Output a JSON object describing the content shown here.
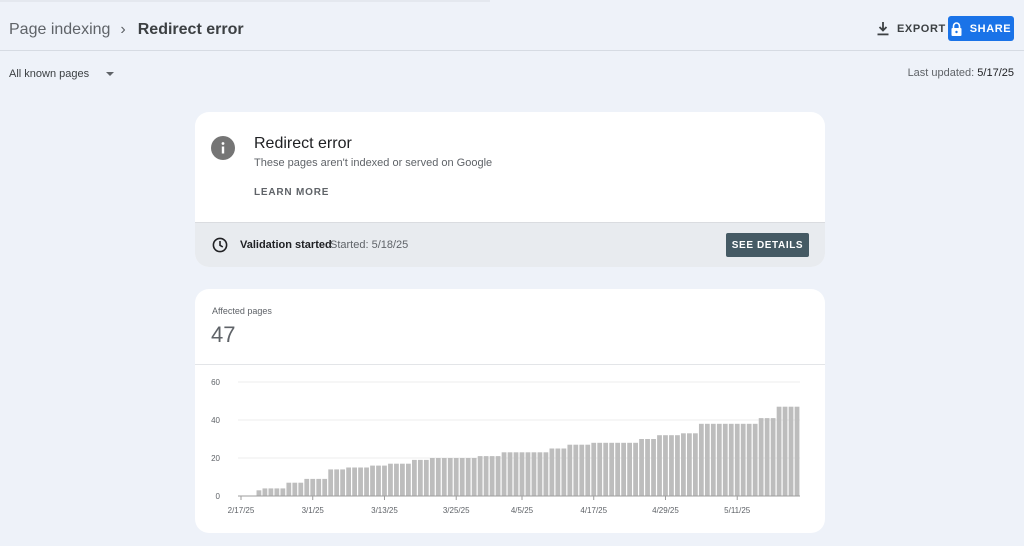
{
  "header": {
    "breadcrumb_parent": "Page indexing",
    "breadcrumb_sep": "›",
    "breadcrumb_current": "Redirect error",
    "export_label": "EXPORT",
    "share_label": "SHARE",
    "accent_color": "#1a73e8"
  },
  "filter": {
    "selected": "All known pages"
  },
  "last_updated": {
    "label": "Last updated:",
    "value": "5/17/25"
  },
  "issue": {
    "icon": "info-icon",
    "title": "Redirect error",
    "subtitle": "These pages aren't indexed or served on Google",
    "learn_more": "LEARN MORE"
  },
  "validation": {
    "icon": "clock-icon",
    "status": "Validation started",
    "started": "Started: 5/18/25",
    "details_label": "SEE DETAILS",
    "button_color": "#455a64"
  },
  "affected": {
    "label": "Affected pages",
    "value": "47"
  },
  "chart_data": {
    "type": "bar",
    "bar_color": "#bdbdbd",
    "ylim": [
      0,
      60
    ],
    "yticks": [
      0,
      20,
      40,
      60
    ],
    "xtick_labels": [
      "2/17/25",
      "3/1/25",
      "3/13/25",
      "3/25/25",
      "4/5/25",
      "4/17/25",
      "4/29/25",
      "5/11/25"
    ],
    "xtick_indices": [
      0,
      12,
      24,
      36,
      47,
      59,
      71,
      83
    ],
    "values": [
      0,
      0,
      0,
      3,
      4,
      4,
      4,
      4,
      7,
      7,
      7,
      9,
      9,
      9,
      9,
      14,
      14,
      14,
      15,
      15,
      15,
      15,
      16,
      16,
      16,
      17,
      17,
      17,
      17,
      19,
      19,
      19,
      20,
      20,
      20,
      20,
      20,
      20,
      20,
      20,
      21,
      21,
      21,
      21,
      23,
      23,
      23,
      23,
      23,
      23,
      23,
      23,
      25,
      25,
      25,
      27,
      27,
      27,
      27,
      28,
      28,
      28,
      28,
      28,
      28,
      28,
      28,
      30,
      30,
      30,
      32,
      32,
      32,
      32,
      33,
      33,
      33,
      38,
      38,
      38,
      38,
      38,
      38,
      38,
      38,
      38,
      38,
      41,
      41,
      41,
      47,
      47,
      47,
      47
    ]
  }
}
